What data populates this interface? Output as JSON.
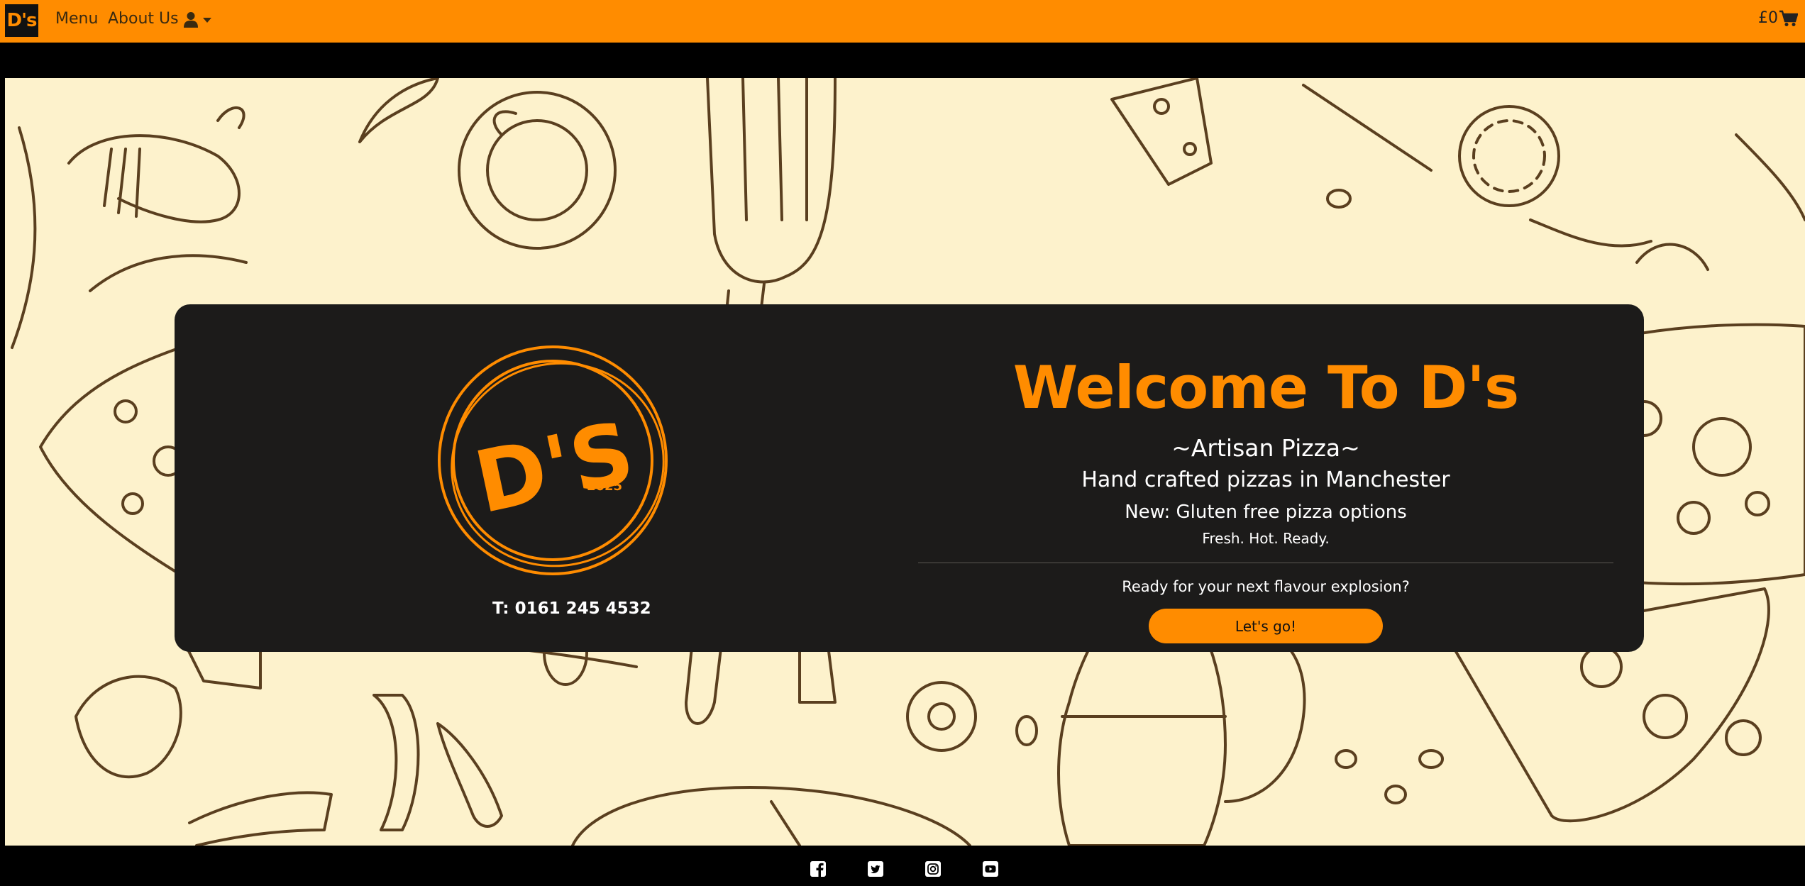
{
  "navbar": {
    "brand": "D's",
    "menu_label": "Menu",
    "about_label": "About Us",
    "user_icon": "user-icon",
    "cart_total": "£0",
    "cart_icon": "cart-icon"
  },
  "hero": {
    "logo_text": "D'S",
    "logo_year": "2025",
    "phone": "T: 0161 245 4532",
    "welcome": "Welcome To D's",
    "tagline": "~Artisan Pizza~",
    "subtitle": "Hand crafted pizzas in Manchester",
    "news": "New: Gluten free pizza options",
    "motto": "Fresh. Hot. Ready.",
    "prompt": "Ready for your next flavour explosion?",
    "cta_label": "Let's go!"
  },
  "footer": {
    "icons": [
      "facebook-icon",
      "twitter-icon",
      "instagram-icon",
      "youtube-icon"
    ]
  },
  "colors": {
    "accent": "#ff8c00",
    "card": "#1c1b1a",
    "background": "#fdf2cc",
    "doodle": "#5a3f1f"
  }
}
